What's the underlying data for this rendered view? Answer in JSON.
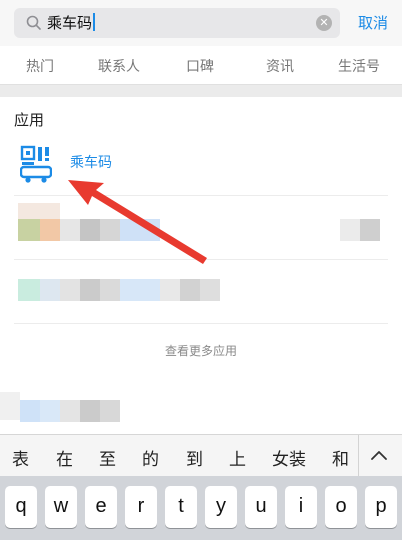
{
  "search": {
    "query": "乘车码",
    "cancel_label": "取消"
  },
  "tabs": [
    {
      "label": "热门"
    },
    {
      "label": "联系人"
    },
    {
      "label": "口碑"
    },
    {
      "label": "资讯"
    },
    {
      "label": "生活号"
    }
  ],
  "apps_section": {
    "title": "应用",
    "first_app": {
      "label": "乘车码",
      "icon": "qr-bus-icon"
    },
    "more_label": "查看更多应用"
  },
  "suggestions": [
    "表",
    "在",
    "至",
    "的",
    "到",
    "上",
    "女装",
    "和"
  ],
  "keyboard": {
    "row1": [
      "q",
      "w",
      "e",
      "r",
      "t",
      "y",
      "u",
      "i",
      "o",
      "p"
    ]
  },
  "colors": {
    "accent": "#1c8be6",
    "annotation_arrow": "#e83a2f"
  }
}
